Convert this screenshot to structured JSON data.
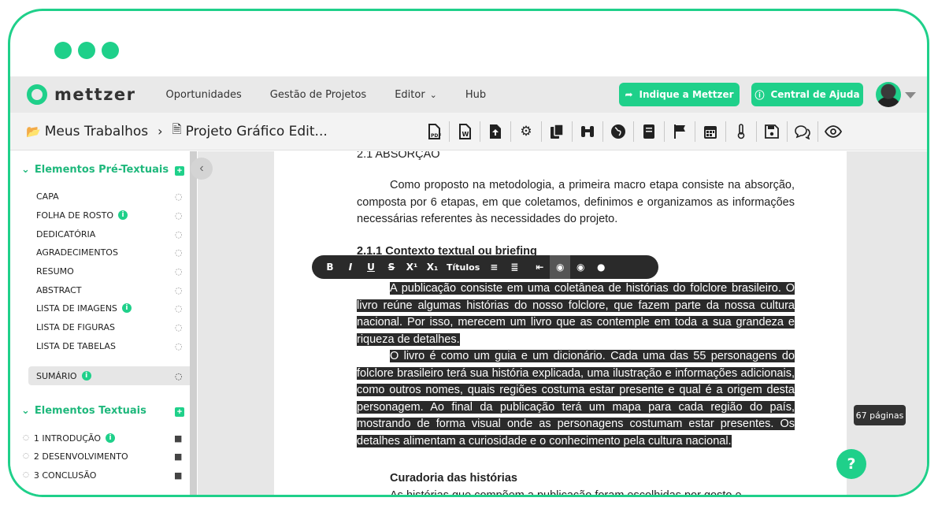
{
  "brand": {
    "logo_text": "mettzer",
    "accent": "#1fd08a"
  },
  "nav": {
    "items": [
      "Oportunidades",
      "Gestão de Projetos",
      "Editor",
      "Hub"
    ],
    "indique": "Indique a Mettzer",
    "central": "Central de Ajuda"
  },
  "breadcrumb": {
    "root": "Meus Trabalhos",
    "current": "Projeto Gráfico Edit..."
  },
  "toolbar_icons": [
    "pdf-export-icon",
    "word-export-icon",
    "upload-icon",
    "settings-icon",
    "copy-icon",
    "binoculars-icon",
    "globe-icon",
    "book-icon",
    "flag-icon",
    "calendar-icon",
    "thermometer-icon",
    "save-icon",
    "comments-icon",
    "eye-icon"
  ],
  "sidebar": {
    "pre_title": "Elementos Pré-Textuais",
    "pre_items": [
      "CAPA",
      "FOLHA DE ROSTO",
      "DEDICATÓRIA",
      "AGRADECIMENTOS",
      "RESUMO",
      "ABSTRACT",
      "LISTA DE IMAGENS",
      "LISTA DE FIGURAS",
      "LISTA DE TABELAS",
      "SUMÁRIO"
    ],
    "text_title": "Elementos Textuais",
    "text_items": [
      "1 INTRODUÇÃO",
      "2 DESENVOLVIMENTO",
      "3 CONCLUSÃO"
    ]
  },
  "doc": {
    "top_heading": "2.1 ABSORÇÃO",
    "p1": "Como proposto na metodologia, a primeira macro etapa consiste na absorção, composta por 6 etapas, em que coletamos, definimos e organizamos as informações necessárias referentes às necessidades do projeto.",
    "h211": "2.1.1 Contexto textual ou briefing",
    "sel1": "A publicação consiste em uma coletânea de histórias do folclore brasileiro. O livro reúne algumas histórias do nosso folclore, que fazem parte da nossa cultura nacional. Por isso, merecem um livro que as contemple em toda a sua grandeza e riqueza de detalhes.",
    "sel2": "O livro é como um guia e um dicionário. Cada uma das 55 personagens do folclore brasileiro terá sua história explicada, uma ilustração e informações adicionais, como outros nomes, quais regiões costuma estar presente e qual é a origem desta personagem. Ao final da publicação terá um mapa para cada região do país, mostrando de forma visual onde as personagens costumam estar presentes. Os detalhes alimentam a curiosidade e o conhecimento pela cultura nacional.",
    "h_curadoria": "Curadoria das histórias",
    "p_last": "As histórias que compõem a publicação foram escolhidas por gosto e"
  },
  "format_toolbar": {
    "bold": "B",
    "italic": "I",
    "underline": "U",
    "strike": "S",
    "sup": "X¹",
    "sub": "X₁",
    "titles": "Títulos"
  },
  "pages_badge": "67 páginas",
  "help": "?"
}
